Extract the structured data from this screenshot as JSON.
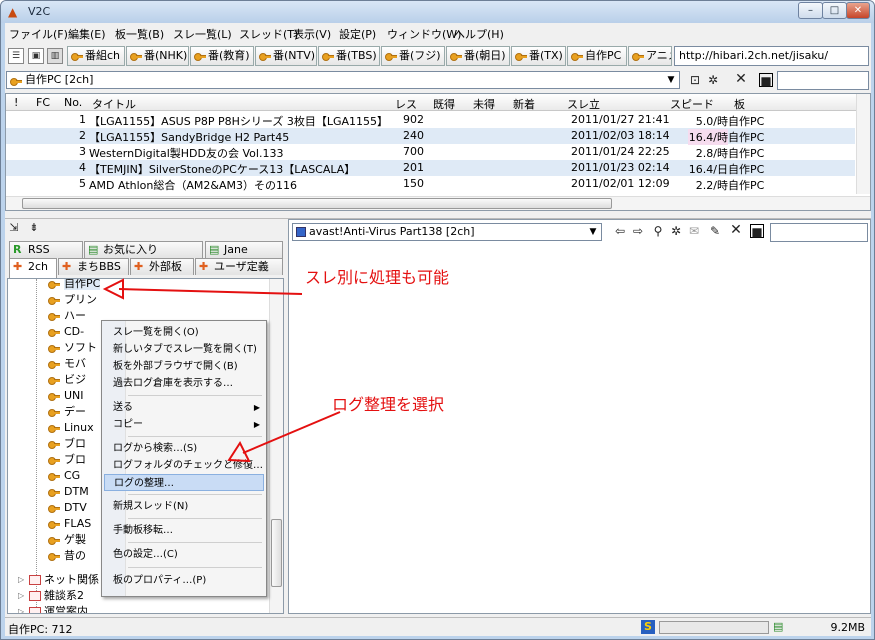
{
  "window": {
    "title": "V2C"
  },
  "menu": [
    "ファイル(F)",
    "編集(E)",
    "板一覧(B)",
    "スレ一覧(L)",
    "スレッド(T)",
    "表示(V)",
    "設定(P)",
    "ウィンドウ(W)",
    "ヘルプ(H)"
  ],
  "bookmarks": [
    "番組ch",
    "番(NHK)",
    "番(教育)",
    "番(NTV)",
    "番(TBS)",
    "番(フジ)",
    "番(朝日)",
    "番(TX)",
    "自作PC",
    "アニメ"
  ],
  "url": "http://hibari.2ch.net/jisaku/",
  "board_combo": "自作PC [2ch]",
  "columns": [
    "!",
    "FC",
    "No.",
    "タイトル",
    "レス",
    "既得",
    "未得",
    "新着",
    "スレ立",
    "スピード",
    "板"
  ],
  "threads": [
    {
      "no": "1",
      "title": "【LGA1155】ASUS P8P P8Hシリーズ 3枚目【LGA1155】",
      "res": "902",
      "date": "2011/01/27 21:41",
      "speed": "5.0/時",
      "board": "自作PC"
    },
    {
      "no": "2",
      "title": "【LGA1155】SandyBridge H2 Part45",
      "res": "240",
      "date": "2011/02/03 18:14",
      "speed": "16.4/時",
      "board": "自作PC"
    },
    {
      "no": "3",
      "title": "WesternDigital製HDD友の会 Vol.133",
      "res": "700",
      "date": "2011/01/24 22:25",
      "speed": "2.8/時",
      "board": "自作PC"
    },
    {
      "no": "4",
      "title": "【TEMJIN】SilverStoneのPCケース13【LASCALA】",
      "res": "201",
      "date": "2011/01/23 02:14",
      "speed": "16.4/日",
      "board": "自作PC"
    },
    {
      "no": "5",
      "title": "AMD Athlon総合（AM2&AM3）その116",
      "res": "150",
      "date": "2011/02/01 12:09",
      "speed": "2.2/時",
      "board": "自作PC"
    }
  ],
  "tabs_top": [
    "RSS",
    "お気に入り",
    "Jane"
  ],
  "tabs_bottom": [
    "2ch",
    "まちBBS",
    "外部板",
    "ユーザ定義"
  ],
  "tree_boards": [
    "自作PC",
    "プリン",
    "ハー",
    "CD-",
    "ソフト",
    "モバ",
    "ビジ",
    "UNI",
    "デー",
    "Linux",
    "ブロ",
    "ブロ",
    "CG",
    "DTM",
    "DTV",
    "FLAS",
    "ゲ製",
    "昔の"
  ],
  "tree_folders": [
    "ネット関係",
    "雑談系2",
    "運営案内"
  ],
  "thread_combo": "avast!Anti-Virus Part138 [2ch]",
  "context_menu": [
    {
      "label": "スレ一覧を開く(O)"
    },
    {
      "label": "新しいタブでスレ一覧を開く(T)"
    },
    {
      "label": "板を外部ブラウザで開く(B)"
    },
    {
      "label": "過去ログ倉庫を表示する…"
    },
    {
      "label": "送る",
      "sub": true
    },
    {
      "label": "コピー",
      "sub": true
    },
    {
      "label": "ログから検索…(S)"
    },
    {
      "label": "ログフォルダのチェックと修復…"
    },
    {
      "label": "ログの整理…",
      "highlight": true
    },
    {
      "label": "新規スレッド(N)"
    },
    {
      "label": "手動板移転…"
    },
    {
      "label": "色の設定…(C)"
    },
    {
      "label": "板のプロパティ…(P)"
    }
  ],
  "annotations": {
    "a1": "スレ別に処理も可能",
    "a2": "ログ整理を選択"
  },
  "status": {
    "left": "自作PC: 712",
    "right": "9.2MB"
  },
  "colors": {
    "accent": "#e41010",
    "selection": "#dfeaf6",
    "menu_highlight": "#c9dcf5"
  }
}
